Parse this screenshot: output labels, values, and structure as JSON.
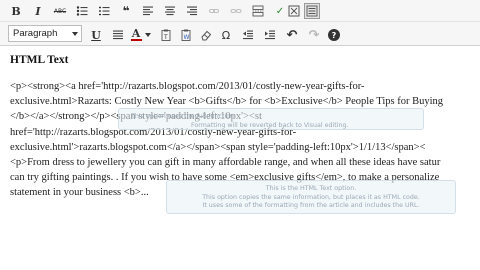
{
  "toolbar": {
    "format_select": {
      "value": "Paragraph"
    },
    "icons_row1": [
      "bold",
      "italic",
      "strikethrough",
      "bullet-list",
      "numbered-list",
      "blockquote",
      "align-left",
      "align-center",
      "align-right",
      "insert-link",
      "remove-link",
      "insert-more",
      "spellcheck",
      "fullscreen",
      "show-kitchen-sink"
    ],
    "icons_row2": [
      "underline",
      "align-justify",
      "text-color",
      "paste-as-text",
      "paste-from-word",
      "clear-formatting",
      "special-character",
      "outdent",
      "indent",
      "undo",
      "redo",
      "help"
    ],
    "glyphs": {
      "bold": "B",
      "italic": "I",
      "strike": "ABC",
      "quote": "❝",
      "spell": "✓",
      "underline": "U",
      "textcolor": "A",
      "omega": "Ω",
      "undo": "↶",
      "redo": "↷",
      "help": "?"
    },
    "text_color_swatch": "#c00000"
  },
  "editor": {
    "title": "HTML Text",
    "lines": [
      "<p><strong><a  href='http://razarts.blogspot.com/2013/01/costly-new-year-gifts-for-",
      "exclusive.html>Razarts: Costly New Year <b>Gifts</b> for <b>Exclusive</b> People Tips for Buying",
      "</b></a></strong></p><span style='padding-left:10px'><st",
      "href='http://razarts.blogspot.com/2013/01/costly-new-year-gifts-for-",
      "exclusive.html'>razarts.blogspot.com</a></span><span style='padding-left:10px'>1/1/13</span><",
      "<p>From dress to jewellery you can gift in many affordable range, and when all these ideas have satur",
      "can try gifting paintings. . If you wish to have some <em>exclusive gifts</em>, to make a personalize",
      "statement in your business <b>..."
    ],
    "tooltip_top": {
      "line1": "This option uses the full function.",
      "line2": "Formatting will be reverted back to Visual editing."
    },
    "tooltip_bottom": {
      "line1": "This is the HTML Text option.",
      "line2": "This option copies the same information, but places it as HTML code.",
      "line3": "It uses some of the formatting from the article and includes the URL."
    }
  }
}
